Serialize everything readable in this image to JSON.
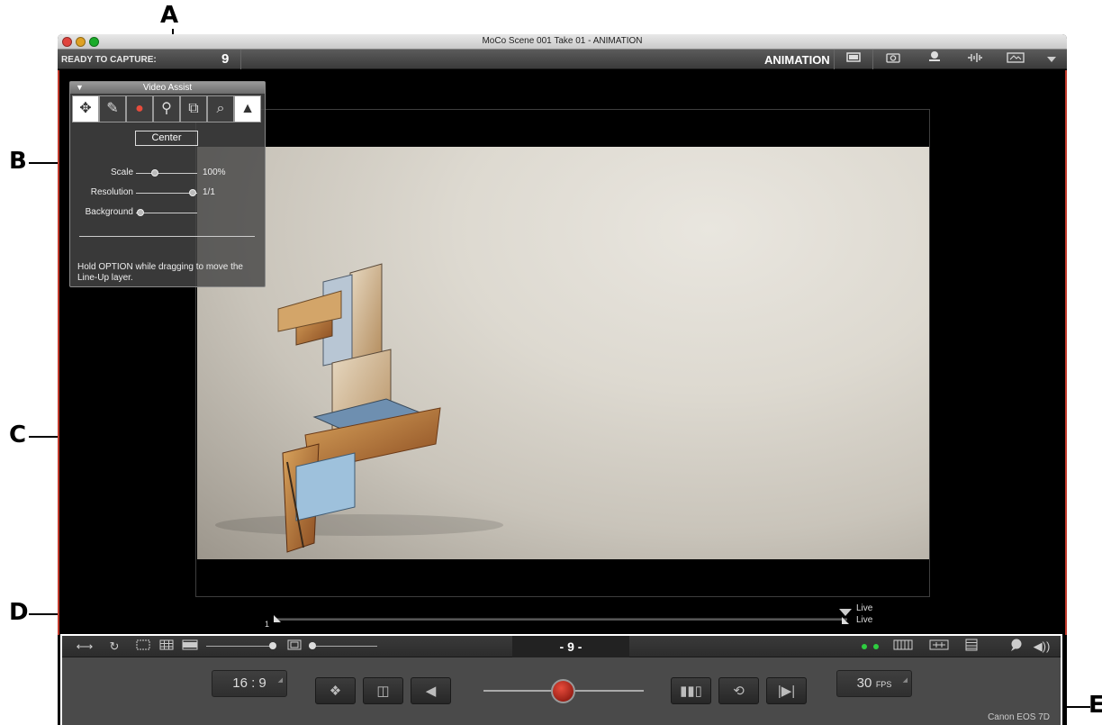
{
  "callouts": {
    "a": "A",
    "b": "B",
    "c": "C",
    "d": "D",
    "e": "E"
  },
  "window": {
    "title": "MoCo  Scene 001  Take 01 - ANIMATION",
    "status": "READY TO CAPTURE:",
    "frame_count": "9",
    "mode": "ANIMATION",
    "toolbar_icons": [
      "monitor-icon",
      "camera-icon",
      "webcam-icon",
      "audio-wave-icon",
      "frame-icon",
      "dropdown-triangle-icon"
    ]
  },
  "video_assist": {
    "title": "Video Assist",
    "tools": [
      "move-icon",
      "pencil-icon",
      "onion-skin-icon",
      "eyedropper-icon",
      "layers-icon",
      "zoom-icon",
      "histogram-icon"
    ],
    "center_button": "Center",
    "scale_label": "Scale",
    "scale_value": "100%",
    "resolution_label": "Resolution",
    "resolution_value": "1/1",
    "background_label": "Background",
    "hint": "Hold OPTION while dragging to move the Line-Up layer."
  },
  "timeline": {
    "start": "1",
    "live_top": "Live",
    "live_bottom": "Live"
  },
  "controls": {
    "frame_display": "- 9 -",
    "aspect": "16 : 9",
    "fps_value": "30",
    "fps_unit": "FPS",
    "camera": "Canon EOS 7D",
    "buttons": [
      "onion-skin-button",
      "loop-mode-button",
      "step-back-button",
      "record-button",
      "playback-frames-button",
      "loop-button",
      "step-forward-button"
    ],
    "colors": {
      "record": "#c0392b",
      "indicator": "#2ecc40",
      "frame_border": "#c0392b"
    }
  }
}
